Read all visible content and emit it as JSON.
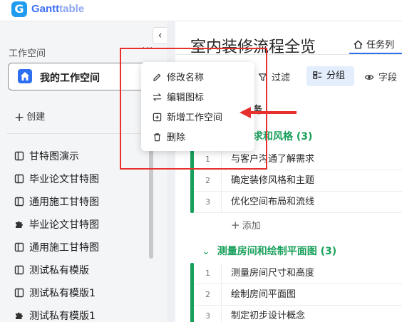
{
  "app": {
    "logo_letter": "G",
    "name_bold": "Gantt",
    "name_light": "table",
    "brand_color": "#3a6ff5"
  },
  "sidebar": {
    "collapse_icon": "chevron-left-icon",
    "workspace_label": "工作空间",
    "more_label": "···",
    "current_workspace": "我的工作空间",
    "create_label": "创建",
    "items": [
      {
        "label": "甘特图演示",
        "icon": "sheet-icon"
      },
      {
        "label": "毕业论文甘特图",
        "icon": "sheet-icon"
      },
      {
        "label": "通用施工甘特图",
        "icon": "sheet-icon"
      },
      {
        "label": "毕业论文甘特图",
        "icon": "puzzle-icon"
      },
      {
        "label": "通用施工甘特图",
        "icon": "sheet-icon"
      },
      {
        "label": "测试私有模版",
        "icon": "sheet-icon"
      },
      {
        "label": "测试私有模版1",
        "icon": "sheet-icon"
      },
      {
        "label": "测试私有模版1",
        "icon": "puzzle-icon"
      }
    ]
  },
  "context_menu": {
    "items": [
      {
        "label": "修改名称",
        "icon": "pencil-icon"
      },
      {
        "label": "编辑图标",
        "icon": "swap-icon"
      },
      {
        "label": "新增工作空间",
        "icon": "plus-square-icon"
      },
      {
        "label": "删除",
        "icon": "trash-icon"
      }
    ]
  },
  "main": {
    "title": "室内装修流程全览",
    "tab_label": "任务列",
    "toolbar": {
      "filter_label": "过滤",
      "group_label": "分组",
      "fields_label": "字段"
    },
    "partial_header": "务",
    "groups": [
      {
        "title": "求和风格 (3)",
        "tasks": [
          {
            "num": "1",
            "name": "与客户沟通了解需求"
          },
          {
            "num": "2",
            "name": "确定装修风格和主题"
          },
          {
            "num": "3",
            "name": "优化空间布局和流线"
          }
        ],
        "add_label": "添加"
      },
      {
        "title": "测量房间和绘制平面图 (3)",
        "tasks": [
          {
            "num": "1",
            "name": "测量房间尺寸和高度"
          },
          {
            "num": "2",
            "name": "绘制房间平面图"
          },
          {
            "num": "3",
            "name": "制定初步设计概念"
          }
        ]
      }
    ],
    "group_color": "#18a05a"
  },
  "annotation_color": "#e8312f"
}
